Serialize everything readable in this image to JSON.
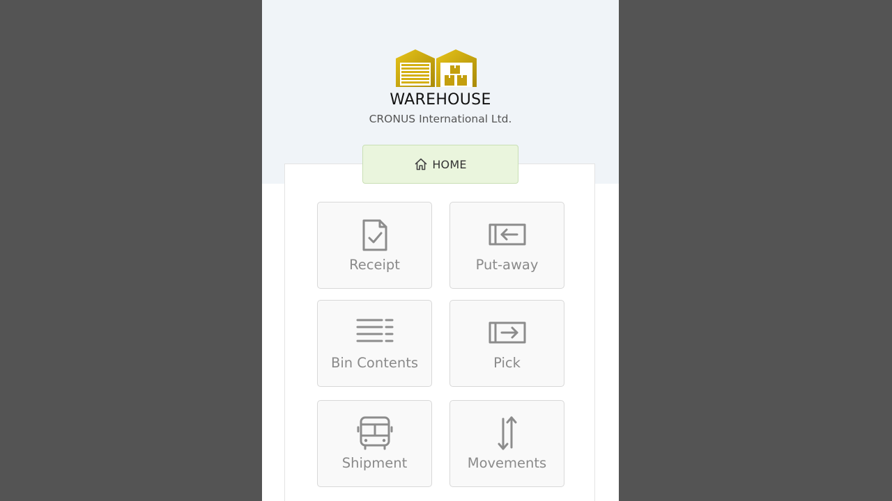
{
  "header": {
    "app_title": "WAREHOUSE",
    "company": "CRONUS International Ltd.",
    "logo_icon": "warehouse-logo-icon",
    "colors": {
      "background": "#545454",
      "header_band": "#f0f4f8",
      "logo_gold": "#d4b012",
      "home_tab_bg": "#eaf5dd",
      "tile_text": "#8a8a8a"
    }
  },
  "nav": {
    "home_label": "HOME",
    "home_icon": "home-icon"
  },
  "tiles": [
    {
      "id": "receipt",
      "label": "Receipt",
      "icon": "document-check-icon"
    },
    {
      "id": "putaway",
      "label": "Put-away",
      "icon": "arrow-into-bin-icon"
    },
    {
      "id": "bin",
      "label": "Bin Contents",
      "icon": "list-lines-icon"
    },
    {
      "id": "pick",
      "label": "Pick",
      "icon": "arrow-out-of-bin-icon"
    },
    {
      "id": "shipment",
      "label": "Shipment",
      "icon": "bus-icon"
    },
    {
      "id": "movements",
      "label": "Movements",
      "icon": "up-down-arrows-icon"
    }
  ]
}
